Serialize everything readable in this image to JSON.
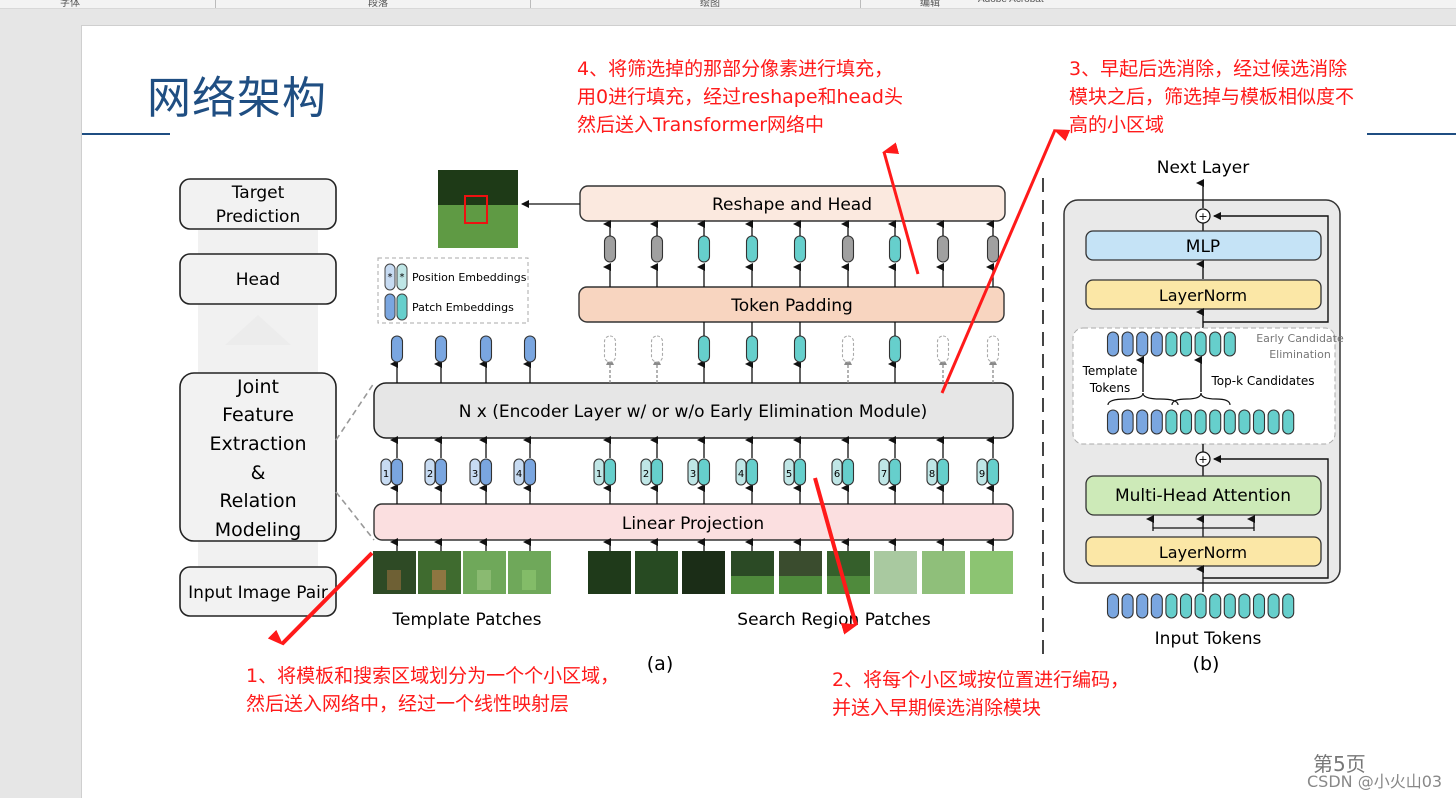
{
  "ribbon": {
    "groups": [
      "字体",
      "段落",
      "绘图",
      "编辑",
      "Adobe Acrobat"
    ]
  },
  "slide": {
    "title": "网络架构",
    "page_label": "第5页",
    "watermark": "CSDN @小火山03"
  },
  "annotations": {
    "note1": [
      "1、将模板和搜索区域划分为一个个小区域，",
      "然后送入网络中，经过一个线性映射层"
    ],
    "note2": [
      "2、将每个小区域按位置进行编码，",
      "并送入早期候选消除模块"
    ],
    "note3": [
      "3、早起后选消除，经过候选消除",
      "模块之后，筛选掉与模板相似度不",
      "高的小区域"
    ],
    "note4": [
      "4、将筛选掉的那部分像素进行填充，",
      "用0进行填充，经过reshape和head头",
      "然后送入Transformer网络中"
    ]
  },
  "diagram_a": {
    "label": "(a)",
    "pipeline": {
      "target_prediction": [
        "Target",
        "Prediction"
      ],
      "head": "Head",
      "joint": [
        "Joint",
        "Feature",
        "Extraction",
        "&",
        "Relation",
        "Modeling"
      ],
      "input_pair": "Input Image Pair"
    },
    "reshape_head": "Reshape and Head",
    "token_padding": "Token Padding",
    "encoder": "N x (Encoder Layer w/ or w/o Early Elimination Module)",
    "linear_projection": "Linear Projection",
    "legend": {
      "position": "Position Embeddings",
      "patch": "Patch Embeddings",
      "marker": "*"
    },
    "template_positions": [
      "1",
      "2",
      "3",
      "4"
    ],
    "search_positions": [
      "1",
      "2",
      "3",
      "4",
      "5",
      "6",
      "7",
      "8",
      "9"
    ],
    "search_kept": [
      false,
      false,
      true,
      true,
      true,
      false,
      true,
      false,
      false
    ],
    "template_label": "Template Patches",
    "search_label": "Search Region Patches"
  },
  "diagram_b": {
    "label": "(b)",
    "next_layer": "Next Layer",
    "mlp": "MLP",
    "layernorm_top": "LayerNorm",
    "ece_title": [
      "Early Candidate",
      "Elimination"
    ],
    "template_tokens": [
      "Template",
      "Tokens"
    ],
    "topk": "Top-k Candidates",
    "mha": "Multi-Head Attention",
    "layernorm_bottom": "LayerNorm",
    "input_tokens": "Input Tokens",
    "plus": "+"
  },
  "colors": {
    "template_token": "#7aa6e0",
    "search_token": "#66cfcc",
    "padded_token": "#a0a0a0",
    "annotation": "#ff1a1a",
    "title": "#1f4e82"
  }
}
